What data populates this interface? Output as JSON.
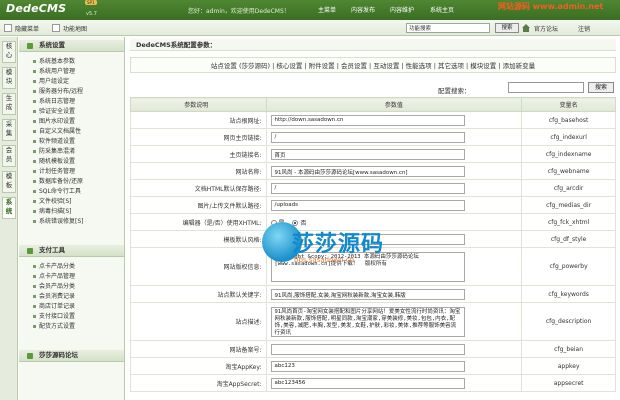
{
  "header": {
    "logo": "DedeCMS",
    "version": "v5.7",
    "badge": "SP1",
    "welcome": "您好：admin，欢迎使用DedeCMS！",
    "nav": [
      "主菜单",
      "内容发布",
      "内容维护",
      "系统主页"
    ],
    "site_mark": "网站源码 www.admin.net"
  },
  "subbar": {
    "hide_menu": "隐藏菜单",
    "func_map": "功能地图",
    "search_value": "功能搜索",
    "search_btn": "搜索",
    "forum": "官方论坛",
    "logout": "注销"
  },
  "vtabs": [
    "核心",
    "模块",
    "生成",
    "采集",
    "会员",
    "模板",
    "系统"
  ],
  "sidebar": {
    "group1_title": "系统设置",
    "group1_items": [
      "系统基本参数",
      "系统用户管理",
      "用户组设定",
      "服务器分布/远程",
      "系统日志管理",
      "验证安全设置",
      "图片水印设置",
      "自定义文档属性",
      "软件频道设置",
      "防采集串混淆",
      "随机模板设置",
      "计划任务管理",
      "数据库备份/还原",
      "SQL命令行工具",
      "文件校验[S]",
      "病毒扫描[S]",
      "系统错误修复[S]"
    ],
    "group2_title": "支付工具",
    "group2_items": [
      "点卡产品分类",
      "点卡产品管理",
      "会员产品分类",
      "会员消费记录",
      "商店订单记录",
      "支付接口设置",
      "配货方式设置"
    ],
    "group3_title": "莎莎源码论坛"
  },
  "main": {
    "panel_title": "DedeCMS系统配置参数：",
    "tabs_line": "站点设置 (莎莎源码) | 核心设置 | 附件设置 | 会员设置 | 互动设置 | 性能选项 | 其它选项 | 模块设置 | 添加新变量",
    "cfg_search_label": "配置搜索：",
    "cfg_search_btn": "搜索",
    "table_headers": [
      "参数说明",
      "参数值",
      "变量名"
    ],
    "rows": [
      {
        "label": "站点根网址:",
        "value": "http://down.sasadown.cn",
        "var": "cfg_basehost"
      },
      {
        "label": "网页主页链接:",
        "value": "/",
        "var": "cfg_indexurl"
      },
      {
        "label": "主页链接名:",
        "value": "首页",
        "var": "cfg_indexname"
      },
      {
        "label": "网站名称:",
        "value": "91风尚 - 本源码由莎莎源码论坛[www.sasadown.cn]",
        "var": "cfg_webname"
      },
      {
        "label": "文档HTML默认保存路径:",
        "value": "/",
        "var": "cfg_arcdir"
      },
      {
        "label": "图片/上传文件默认路径:",
        "value": "/uploads",
        "var": "cfg_medias_dir"
      },
      {
        "label": "编辑器（是/否）使用XHTML:",
        "radio_yes": "是",
        "radio_no": "否",
        "var": "cfg_fck_xhtml"
      },
      {
        "label": "模板默认风格:",
        "value": "",
        "var": "cfg_df_style"
      },
      {
        "label": "网站版权信息:",
        "value": "Copyright &copy; 2012-2013 本源码由莎莎源码论坛[www.sasadown.cn]提供下载！  版权所有",
        "var": "cfg_powerby"
      },
      {
        "label": "站点默认关键字:",
        "value": "91风尚,服饰搭配,女装,淘宝网秋装新款,淘宝女装,韩版",
        "var": "cfg_keywords"
      },
      {
        "label": "站点描述:",
        "value": "91风尚首页-淘宝网女装搭配和图片分享网站！爱美女性流行时尚资讯：淘宝网秋装新款,服饰搭配,明星同款,淘宝潮家,穿美装修,美妆,包包,内衣,配饰,美容,减肥,丰胸,发型,美发,女鞋,护肤,彩妆,美体,推荐等服饰美容流行资讯",
        "var": "cfg_description"
      },
      {
        "label": "网站备案号:",
        "value": "",
        "var": "cfg_beian"
      },
      {
        "label": "淘宝AppKey:",
        "value": "abc123",
        "var": "appkey"
      },
      {
        "label": "淘宝AppSecret:",
        "value": "abc123456",
        "var": "appsecret"
      }
    ]
  },
  "watermark": {
    "text": "莎莎源码",
    "url": "bbs.sasadown.cn"
  },
  "colors": {
    "topbar": "#3b6d22",
    "accent": "#5a9a3a",
    "watermark_blue": "#1188cc"
  }
}
